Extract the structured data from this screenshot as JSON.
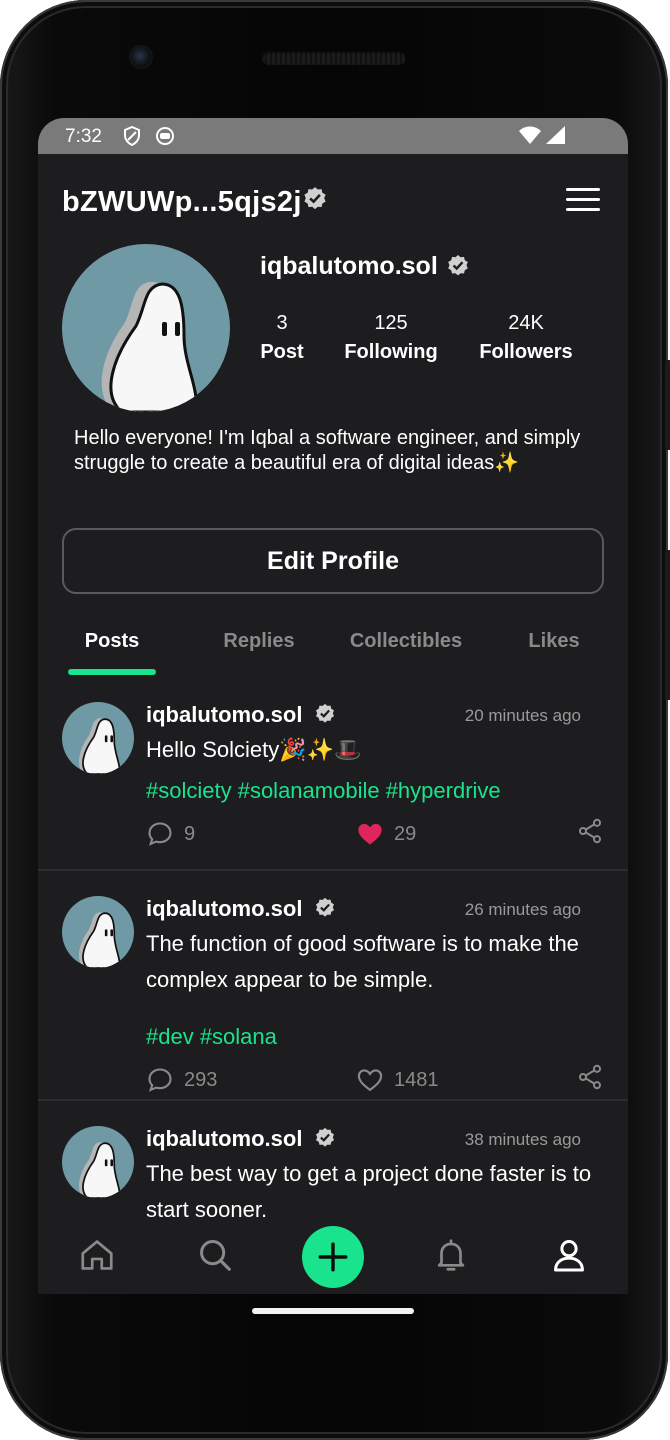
{
  "status": {
    "time": "7:32"
  },
  "header": {
    "wallet": "bZWUWp...5qjs2j"
  },
  "profile": {
    "name": "iqbalutomo.sol",
    "stats": [
      {
        "num": "3",
        "label": "Post"
      },
      {
        "num": "125",
        "label": "Following"
      },
      {
        "num": "24K",
        "label": "Followers"
      }
    ],
    "bio": "Hello everyone! I'm Iqbal a software engineer, and simply struggle to create a beautiful era of digital ideas✨",
    "edit_label": "Edit Profile"
  },
  "tabs": [
    "Posts",
    "Replies",
    "Collectibles",
    "Likes"
  ],
  "active_tab": "Posts",
  "posts": [
    {
      "user": "iqbalutomo.sol",
      "time": "20 minutes ago",
      "text": "Hello Solciety🎉✨🎩",
      "tags": "#solciety #solanamobile #hyperdrive",
      "comments": "9",
      "likes": "29",
      "liked": true
    },
    {
      "user": "iqbalutomo.sol",
      "time": "26 minutes ago",
      "text": "The function of good software is to make the complex appear to be simple.",
      "tags": "#dev #solana",
      "comments": "293",
      "likes": "1481",
      "liked": false
    },
    {
      "user": "iqbalutomo.sol",
      "time": "38 minutes ago",
      "text": "The best way to get a project done faster is to start sooner.",
      "tags": "",
      "comments": "",
      "likes": "",
      "liked": false
    }
  ],
  "colors": {
    "accent": "#19e38c",
    "like": "#e0245e",
    "background": "#1d1d1f"
  },
  "icons": [
    "home-icon",
    "search-icon",
    "plus-icon",
    "bell-icon",
    "user-icon",
    "menu-icon",
    "verified-icon",
    "comment-icon",
    "heart-icon",
    "share-icon"
  ]
}
